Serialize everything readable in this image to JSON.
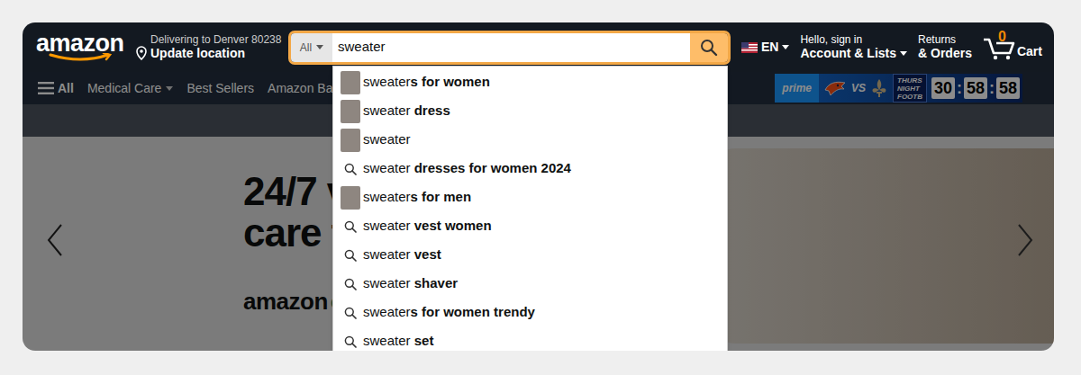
{
  "header": {
    "logo": "amazon",
    "location": {
      "line1": "Delivering to Denver 80238",
      "line2": "Update location"
    },
    "search": {
      "category": "All",
      "query": "sweater",
      "focused": true
    },
    "language": "EN",
    "account": {
      "line1": "Hello, sign in",
      "line2": "Account & Lists"
    },
    "returns": {
      "line1": "Returns",
      "line2": "& Orders"
    },
    "cart": {
      "count": "0",
      "label": "Cart"
    }
  },
  "suggestions": [
    {
      "typed": "sweater",
      "completion": "s for women",
      "kind": "thumbnail"
    },
    {
      "typed": "sweater",
      "completion": " dress",
      "kind": "thumbnail"
    },
    {
      "typed": "sweater",
      "kind": "thumbnail"
    },
    {
      "typed": "sweater",
      "completion": " dresses for women 2024",
      "kind": "query"
    },
    {
      "typed": "sweater",
      "completion": "s for men",
      "kind": "thumbnail"
    },
    {
      "typed": "sweater",
      "completion": " vest women",
      "kind": "query"
    },
    {
      "typed": "sweater",
      "completion": " vest",
      "kind": "query"
    },
    {
      "typed": "sweater",
      "completion": " shaver",
      "kind": "query"
    },
    {
      "typed": "sweater",
      "completion": "s for women trendy",
      "kind": "query"
    },
    {
      "typed": "sweater",
      "completion": " set",
      "kind": "query"
    }
  ],
  "nav": {
    "menu": "All",
    "items": [
      {
        "label": "Medical Care",
        "dropdown": true
      },
      {
        "label": "Best Sellers",
        "dropdown": false
      },
      {
        "label": "Amazon Basics",
        "dropdown": false
      }
    ],
    "promo": {
      "brand": "prime",
      "versus": "VS",
      "event": [
        "THURS",
        "NIGHT",
        "FOOTB"
      ],
      "countdown": [
        "30",
        "58",
        "58"
      ],
      "separator": ":"
    }
  },
  "hero": {
    "headline": [
      "24/7 v",
      "care t"
    ],
    "brand": "amazon",
    "brand_suffix": "on"
  },
  "overlay": {
    "dimmed": true
  }
}
